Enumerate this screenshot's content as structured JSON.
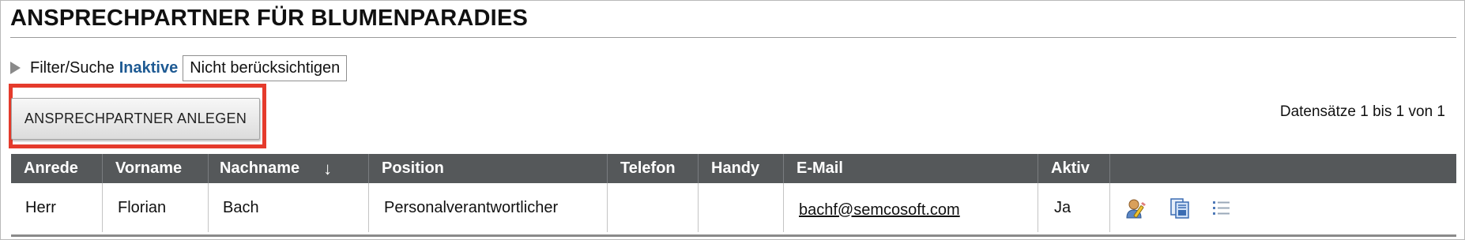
{
  "page": {
    "title": "ANSPRECHPARTNER FÜR BLUMENPARADIES"
  },
  "filter": {
    "toggle_label": "Filter/Suche",
    "inactive_label": "Inaktive",
    "inactive_value": "Nicht berücksichtigen"
  },
  "toolbar": {
    "create_label": "ANSPRECHPARTNER ANLEGEN"
  },
  "records": {
    "summary": "Datensätze 1 bis 1 von 1"
  },
  "table": {
    "headers": [
      "Anrede",
      "Vorname",
      "Nachname",
      "Position",
      "Telefon",
      "Handy",
      "E-Mail",
      "Aktiv",
      ""
    ],
    "sort_indicator": "↓",
    "rows": [
      {
        "anrede": "Herr",
        "vorname": "Florian",
        "nachname": "Bach",
        "position": "Personalverantwortlicher",
        "telefon": "",
        "handy": "",
        "email": "bachf@semcosoft.com",
        "aktiv": "Ja",
        "actions": [
          "edit-contact-icon",
          "copy-record-icon",
          "details-list-icon"
        ]
      }
    ]
  },
  "colors": {
    "header_bg": "#55585a",
    "link_blue": "#1e5a93",
    "highlight_red": "#e53b2c"
  }
}
